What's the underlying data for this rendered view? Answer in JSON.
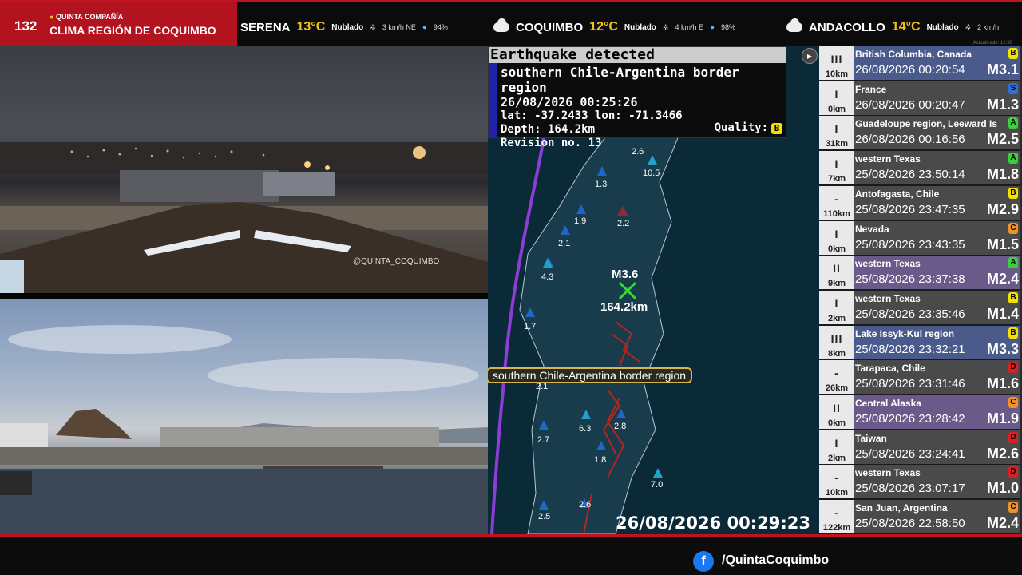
{
  "brand": {
    "number": "132",
    "company": "QUINTA COMPAÑÍA",
    "title": "CLIMA REGIÓN DE COQUIMBO"
  },
  "weather": [
    {
      "city": "SERENA",
      "temp": "13°C",
      "cond": "Nublado",
      "wind": "3 km/h NE",
      "humidity": "94%"
    },
    {
      "city": "COQUIMBO",
      "temp": "12°C",
      "cond": "Nublado",
      "wind": "4 km/h E",
      "humidity": "98%"
    },
    {
      "city": "ANDACOLLO",
      "temp": "14°C",
      "cond": "Nublado",
      "wind": "2 km/h"
    }
  ],
  "updated": "Actualizado: 12:30",
  "cam1": {
    "watermark": "@QUINTA_COQUIMBO"
  },
  "alert": {
    "header": "Earthquake detected",
    "region": "southern Chile-Argentina border region",
    "datetime": "26/08/2026 00:25:26",
    "latlon": "lat: -37.2433 lon: -71.3466",
    "depth": "Depth: 164.2km",
    "revision": "Revision no. 13",
    "quality_label": "Quality:",
    "quality": "B"
  },
  "map": {
    "epicenter_mag": "M3.6",
    "epicenter_depth": "164.2km",
    "region_label": "southern Chile-Argentina border region",
    "clock": "26/08/2026 00:29:23",
    "station_labels": [
      "2.6",
      "10.5",
      "1.3",
      "1.9",
      "2.2",
      "2.1",
      "4.3",
      "1.7",
      "2.1",
      "6.3",
      "2.8",
      "2.7",
      "1.8",
      "7.0",
      "2.6",
      "2.5"
    ]
  },
  "quakes": [
    {
      "place": "British Columbia, Canada",
      "time": "26/08/2026 00:20:54",
      "mag": "M3.1",
      "depth": "10km",
      "intensity": "III",
      "badge": "B",
      "badge_color": "#f2e200",
      "bg": "#4a5a8a"
    },
    {
      "place": "France",
      "time": "26/08/2026 00:20:47",
      "mag": "M1.3",
      "depth": "0km",
      "intensity": "I",
      "badge": "S",
      "badge_color": "#2f6fd6",
      "bg": "#4a4a4a"
    },
    {
      "place": "Guadeloupe region, Leeward Isl...",
      "time": "26/08/2026 00:16:56",
      "mag": "M2.5",
      "depth": "31km",
      "intensity": "I",
      "badge": "A",
      "badge_color": "#3bd13b",
      "bg": "#4a4a4a"
    },
    {
      "place": "western Texas",
      "time": "25/08/2026 23:50:14",
      "mag": "M1.8",
      "depth": "7km",
      "intensity": "I",
      "badge": "A",
      "badge_color": "#3bd13b",
      "bg": "#4a4a4a"
    },
    {
      "place": "Antofagasta, Chile",
      "time": "25/08/2026 23:47:35",
      "mag": "M2.9",
      "depth": "110km",
      "intensity": "-",
      "badge": "B",
      "badge_color": "#f2e200",
      "bg": "#4a4a4a"
    },
    {
      "place": "Nevada",
      "time": "25/08/2026 23:43:35",
      "mag": "M1.5",
      "depth": "0km",
      "intensity": "I",
      "badge": "C",
      "badge_color": "#f0922a",
      "bg": "#4a4a4a"
    },
    {
      "place": "western Texas",
      "time": "25/08/2026 23:37:38",
      "mag": "M2.4",
      "depth": "9km",
      "intensity": "II",
      "badge": "A",
      "badge_color": "#3bd13b",
      "bg": "#6a5a8a"
    },
    {
      "place": "western Texas",
      "time": "25/08/2026 23:35:46",
      "mag": "M1.4",
      "depth": "2km",
      "intensity": "I",
      "badge": "B",
      "badge_color": "#f2e200",
      "bg": "#4a4a4a"
    },
    {
      "place": "Lake Issyk-Kul region",
      "time": "25/08/2026 23:32:21",
      "mag": "M3.3",
      "depth": "8km",
      "intensity": "III",
      "badge": "B",
      "badge_color": "#f2e200",
      "bg": "#4a5a8a"
    },
    {
      "place": "Tarapaca, Chile",
      "time": "25/08/2026 23:31:46",
      "mag": "M1.6",
      "depth": "26km",
      "intensity": "-",
      "badge": "D",
      "badge_color": "#d92020",
      "bg": "#4a4a4a"
    },
    {
      "place": "Central Alaska",
      "time": "25/08/2026 23:28:42",
      "mag": "M1.9",
      "depth": "0km",
      "intensity": "II",
      "badge": "C",
      "badge_color": "#f0922a",
      "bg": "#6a5a8a"
    },
    {
      "place": "Taiwan",
      "time": "25/08/2026 23:24:41",
      "mag": "M2.6",
      "depth": "2km",
      "intensity": "I",
      "badge": "D",
      "badge_color": "#d92020",
      "bg": "#4a4a4a"
    },
    {
      "place": "western Texas",
      "time": "25/08/2026 23:07:17",
      "mag": "M1.0",
      "depth": "10km",
      "intensity": "-",
      "badge": "D",
      "badge_color": "#d92020",
      "bg": "#4a4a4a"
    },
    {
      "place": "San Juan, Argentina",
      "time": "25/08/2026 22:58:50",
      "mag": "M2.4",
      "depth": "122km",
      "intensity": "-",
      "badge": "C",
      "badge_color": "#f0922a",
      "bg": "#4a4a4a"
    }
  ],
  "footer": {
    "social_handle": "/QuintaCoquimbo"
  }
}
